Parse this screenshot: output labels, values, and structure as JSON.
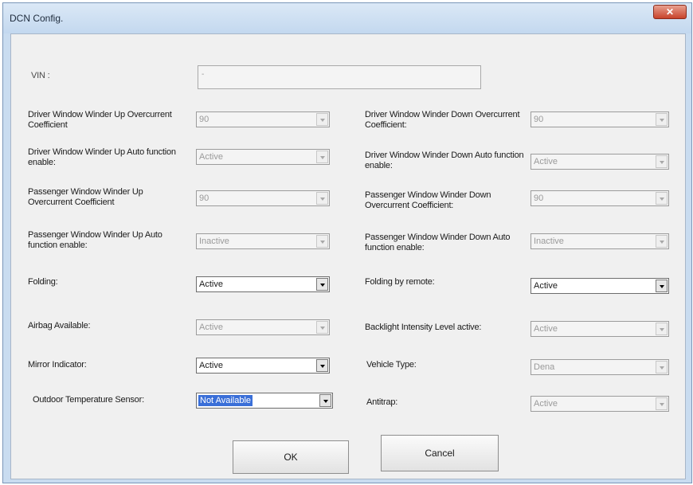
{
  "window": {
    "title": "DCN Config.",
    "close_icon": "✕"
  },
  "vin": {
    "label": "VIN :",
    "value": "-"
  },
  "fields": {
    "driver_up_overcurrent": {
      "label": "Driver Window Winder Up Overcurrent Coefficient",
      "value": "90",
      "enabled": false
    },
    "driver_down_overcurrent": {
      "label": "Driver Window Winder Down Overcurrent Coefficient:",
      "value": "90",
      "enabled": false
    },
    "driver_up_auto": {
      "label": "Driver Window Winder Up Auto function enable:",
      "value": "Active",
      "enabled": false
    },
    "driver_down_auto": {
      "label": "Driver Window Winder Down Auto function enable:",
      "value": "Active",
      "enabled": false
    },
    "passenger_up_overcurrent": {
      "label": "Passenger Window Winder Up Overcurrent Coefficient",
      "value": "90",
      "enabled": false
    },
    "passenger_down_overcurrent": {
      "label": "Passenger Window Winder Down Overcurrent Coefficient:",
      "value": "90",
      "enabled": false
    },
    "passenger_up_auto": {
      "label": "Passenger Window Winder Up Auto function enable:",
      "value": "Inactive",
      "enabled": false
    },
    "passenger_down_auto": {
      "label": "Passenger Window Winder Down Auto function enable:",
      "value": "Inactive",
      "enabled": false
    },
    "folding": {
      "label": "Folding:",
      "value": "Active",
      "enabled": true
    },
    "folding_by_remote": {
      "label": "Folding by remote:",
      "value": "Active",
      "enabled": true
    },
    "airbag_available": {
      "label": "Airbag Available:",
      "value": "Active",
      "enabled": false
    },
    "backlight_intensity": {
      "label": "Backlight Intensity Level active:",
      "value": "Active",
      "enabled": false
    },
    "mirror_indicator": {
      "label": "Mirror Indicator:",
      "value": "Active",
      "enabled": true
    },
    "vehicle_type": {
      "label": "Vehicle Type:",
      "value": "Dena",
      "enabled": false
    },
    "outdoor_temp_sensor": {
      "label": "Outdoor Temperature Sensor:",
      "value": "Not Available",
      "enabled": true,
      "selected": true
    },
    "antitrap": {
      "label": "Antitrap:",
      "value": "Active",
      "enabled": false
    }
  },
  "buttons": {
    "ok": "OK",
    "cancel": "Cancel"
  },
  "colors": {
    "selection": "#3a6fd8",
    "close_button": "#c8432b",
    "frame": "#c9dcf0"
  }
}
